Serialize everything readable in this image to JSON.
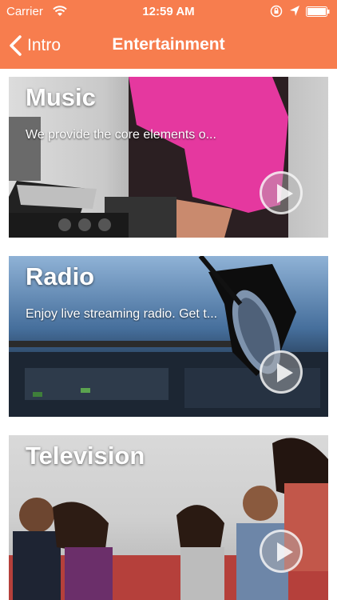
{
  "status_bar": {
    "carrier": "Carrier",
    "time": "12:59 AM",
    "icons": [
      "wifi-icon",
      "lock-rotation-icon",
      "location-arrow-icon",
      "battery-icon"
    ]
  },
  "nav": {
    "back_label": "Intro",
    "title": "Entertainment"
  },
  "colors": {
    "header": "#f77d4e",
    "accent_dj_shirt": "#e5389f"
  },
  "cards": [
    {
      "title": "Music",
      "subtitle": "We provide the core elements o..."
    },
    {
      "title": "Radio",
      "subtitle": "Enjoy live streaming radio. Get t..."
    },
    {
      "title": "Television",
      "subtitle": ""
    }
  ]
}
